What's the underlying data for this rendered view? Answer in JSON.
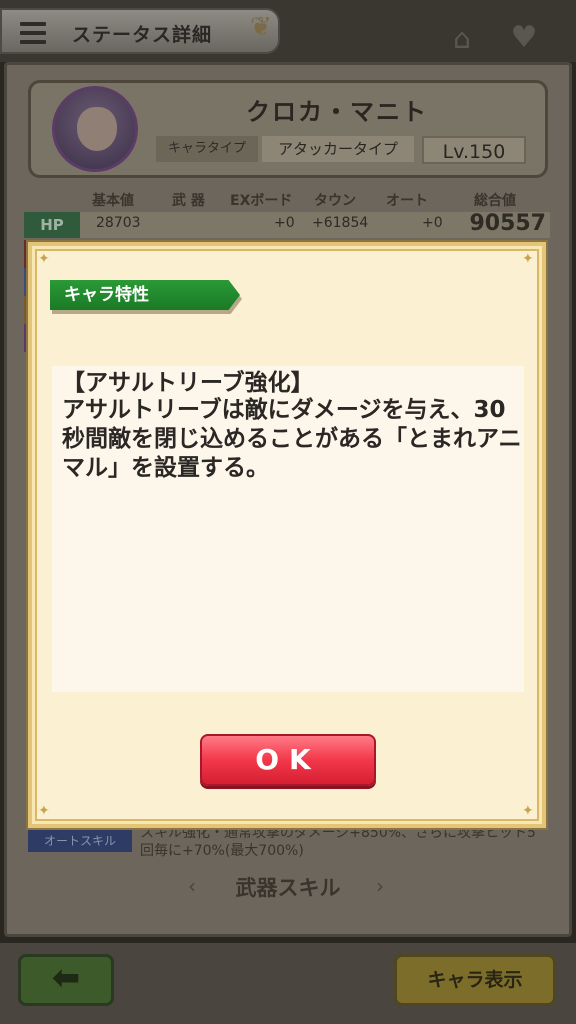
{
  "header": {
    "title": "ステータス詳細"
  },
  "character": {
    "name": "クロカ・マニト",
    "type_label": "キャラタイプ",
    "type_value": "アタッカータイプ",
    "level": "Lv.150"
  },
  "stats": {
    "headers": [
      "基本値",
      "武 器",
      "EXボード",
      "タウン",
      "オート",
      "総合値"
    ],
    "hp": {
      "label": "HP",
      "base": "28703",
      "exboard": "+0",
      "town": "+61854",
      "auto": "+0",
      "total": "90557"
    }
  },
  "auto_skill": {
    "label": "オートスキル",
    "description": "スキル強化・通常攻撃のダメージ+850%、さらに攻撃ヒット5回毎に+70%(最大700%)"
  },
  "weapon_skill": {
    "label": "武器スキル"
  },
  "footer": {
    "back_icon": "arrow-left-icon",
    "chara_view_label": "キャラ表示"
  },
  "dialog": {
    "tag": "キャラ特性",
    "trait_title": "【アサルトリーブ強化】",
    "trait_body": "アサルトリーブは敵にダメージを与え、30秒間敵を閉じ込めることがある「とまれアニマル」を設置する。",
    "ok_label": "OK"
  },
  "colors": {
    "ok_button": "#f2384a",
    "tag_green": "#1a7a26",
    "dialog_bg": "#fbf0d2"
  }
}
